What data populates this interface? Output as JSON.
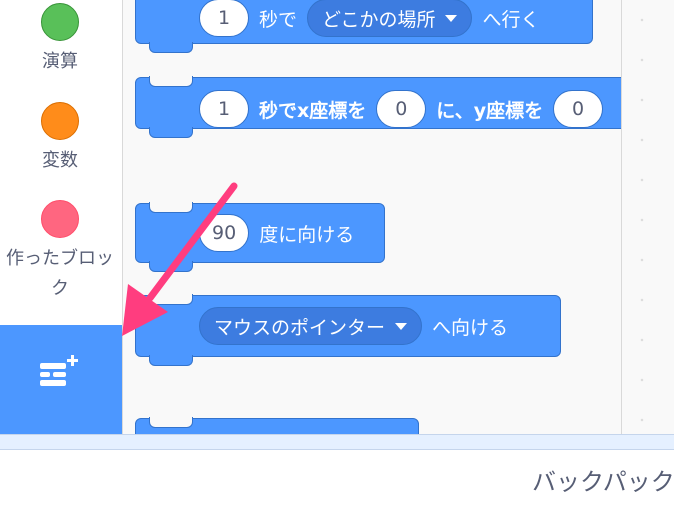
{
  "categories": [
    {
      "label": "演算",
      "color": "#59c059",
      "border": "#389438"
    },
    {
      "label": "変数",
      "color": "#ff8c1a",
      "border": "#db6e00"
    },
    {
      "label": "作ったブロック",
      "color": "#ff6680",
      "border": "#ff4d6a"
    }
  ],
  "extension_button": {
    "icon": "add-extension-icon"
  },
  "blocks": {
    "glide_random": {
      "secs": "1",
      "text1": "秒で",
      "dropdown": "どこかの場所",
      "text2": "へ行く"
    },
    "glide_xy": {
      "secs": "1",
      "text1": "秒でx座標を",
      "x": "0",
      "text2": "に、y座標を",
      "y": "0"
    },
    "point_direction": {
      "degrees": "90",
      "text": "度に向ける"
    },
    "point_towards": {
      "dropdown": "マウスのポインター",
      "text": "へ向ける"
    }
  },
  "backpack": {
    "label": "バックパック"
  },
  "colors": {
    "motion": "#4c97ff",
    "motion_dark": "#3373cc",
    "accent_arrow": "#ff3d7f"
  }
}
